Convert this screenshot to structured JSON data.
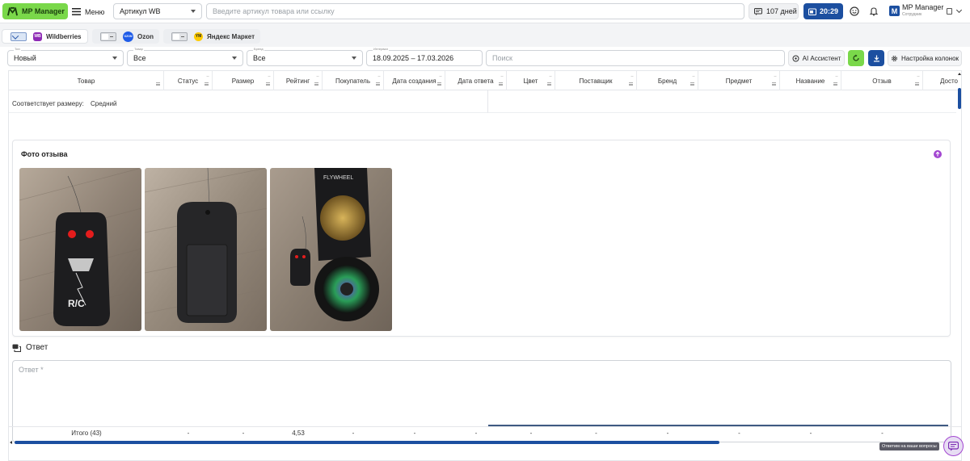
{
  "header": {
    "logo": "MP Manager",
    "menu_label": "Меню",
    "article_select": "Артикул WB",
    "search_placeholder": "Введите артикул товара или ссылку",
    "days_label": "107 дней",
    "time_label": "20:29",
    "user_name": "MP Manager",
    "user_role": "Сотрудник",
    "user_initial": "M"
  },
  "marketplaces": [
    {
      "label": "Wildberries",
      "icon": "WB",
      "enabled": true,
      "color": "#8e2bb5"
    },
    {
      "label": "Ozon",
      "icon": "OZON",
      "enabled": false,
      "color": "#1f5ce8"
    },
    {
      "label": "Яндекс Маркет",
      "icon": "YM",
      "enabled": false,
      "color": "#ffcc00"
    }
  ],
  "filters": {
    "type": {
      "label": "Тип",
      "value": "Новый"
    },
    "product": {
      "label": "Товар",
      "value": "Все"
    },
    "brand": {
      "label": "Бренд",
      "value": "Все"
    },
    "interval": {
      "label": "Интервал",
      "value": "18.09.2025 – 17.03.2026"
    },
    "search_placeholder": "Поиск",
    "ai_assistant": "AI Ассистент",
    "column_settings": "Настройка колонок"
  },
  "table": {
    "columns": [
      "Товар",
      "Статус",
      "Размер",
      "Рейтинг",
      "Покупатель",
      "Дата создания",
      "Дата ответа",
      "Цвет",
      "Поставщик",
      "Бренд",
      "Предмет",
      "Название",
      "Отзыв",
      "Досто"
    ],
    "detail": {
      "size_fit_label": "Соответствует размеру:",
      "size_fit_value": "Средний"
    },
    "photos_title": "Фото отзыва",
    "reply_title": "Ответ",
    "reply_placeholder": "Ответ *",
    "footer": {
      "total_label": "Итого (43)",
      "cells": [
        "-",
        "-",
        "4,53",
        "-",
        "-",
        "-",
        "-",
        "-",
        "-",
        "-",
        "-",
        "-"
      ]
    }
  },
  "support_tooltip": "Ответим на ваши вопросы",
  "colors": {
    "brand_green": "#7ad84a",
    "primary_blue": "#1c4fa0",
    "purple_accent": "#a347d1"
  }
}
